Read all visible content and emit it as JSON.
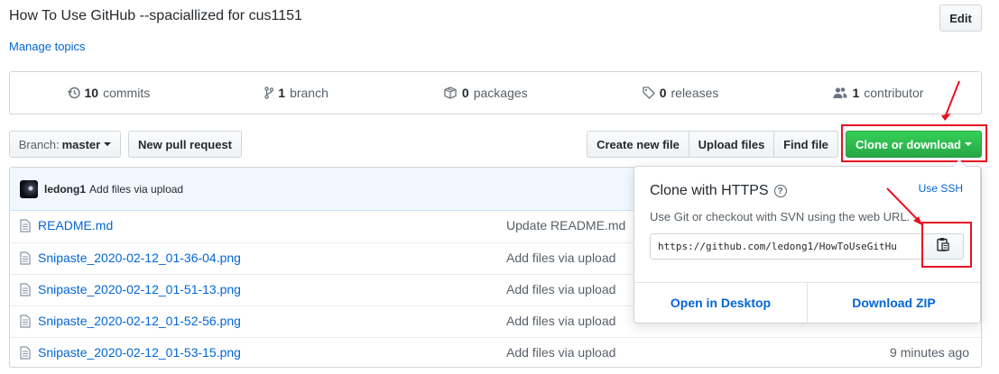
{
  "repo": {
    "title": "How To Use GitHub --spaciallized for cus1151",
    "manage_topics": "Manage topics",
    "edit_label": "Edit"
  },
  "summary": {
    "commits_count": "10",
    "commits_label": "commits",
    "branch_count": "1",
    "branch_label": "branch",
    "packages_count": "0",
    "packages_label": "packages",
    "releases_count": "0",
    "releases_label": "releases",
    "contributor_count": "1",
    "contributor_label": "contributor"
  },
  "toolbar": {
    "branch_prefix": "Branch:",
    "branch_value": "master",
    "new_pull_request": "New pull request",
    "create_new_file": "Create new file",
    "upload_files": "Upload files",
    "find_file": "Find file",
    "clone_or_download": "Clone or download"
  },
  "latest_commit": {
    "author": "ledong1",
    "message": "Add files via upload"
  },
  "files": [
    {
      "name": "README.md",
      "commit": "Update README.md",
      "age": ""
    },
    {
      "name": "Snipaste_2020-02-12_01-36-04.png",
      "commit": "Add files via upload",
      "age": ""
    },
    {
      "name": "Snipaste_2020-02-12_01-51-13.png",
      "commit": "Add files via upload",
      "age": ""
    },
    {
      "name": "Snipaste_2020-02-12_01-52-56.png",
      "commit": "Add files via upload",
      "age": ""
    },
    {
      "name": "Snipaste_2020-02-12_01-53-15.png",
      "commit": "Add files via upload",
      "age": "9 minutes ago"
    }
  ],
  "clone_dropdown": {
    "title": "Clone with HTTPS",
    "use_ssh": "Use SSH",
    "description": "Use Git or checkout with SVN using the web URL.",
    "url": "https://github.com/ledong1/HowToUseGitHu",
    "open_in_desktop": "Open in Desktop",
    "download_zip": "Download ZIP"
  },
  "colors": {
    "link": "#0366d6",
    "primary_green": "#28a745",
    "annotation_red": "#e81123"
  }
}
